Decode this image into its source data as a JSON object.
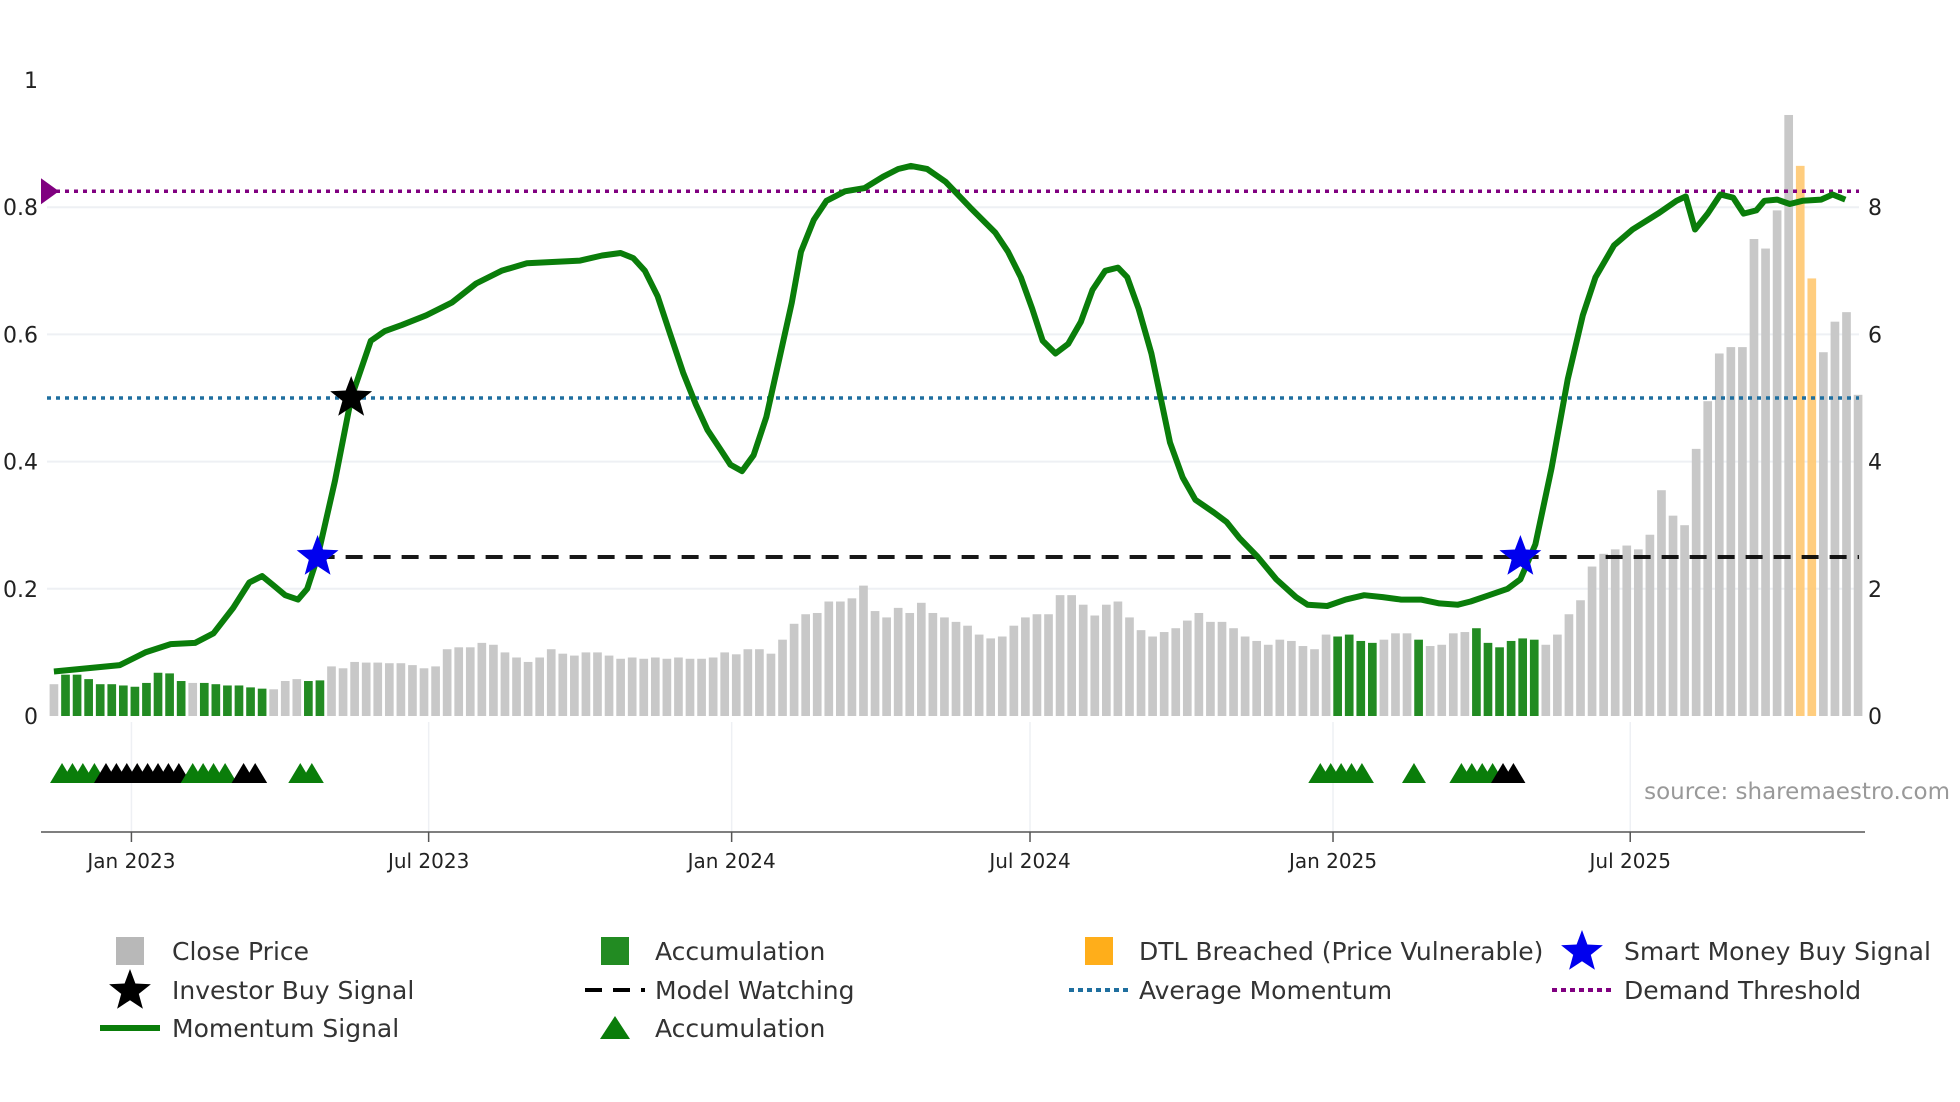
{
  "chart_data": {
    "type": "bar+line",
    "title": "",
    "source": "source: sharemaestro.com",
    "left_axis": {
      "ticks": [
        "0",
        "0.2",
        "0.4",
        "0.6",
        "0.8",
        "1"
      ],
      "values": [
        0,
        0.2,
        0.4,
        0.6,
        0.8,
        1
      ],
      "range": [
        0,
        1
      ]
    },
    "right_axis": {
      "ticks": [
        "0",
        "2",
        "4",
        "6",
        "8"
      ],
      "values": [
        0,
        2,
        4,
        6,
        8
      ],
      "range": [
        0,
        10
      ]
    },
    "x_ticks": [
      {
        "label": "Jan 2023",
        "week": 6.7
      },
      {
        "label": "Jul 2023",
        "week": 32.4
      },
      {
        "label": "Jan 2024",
        "week": 58.6
      },
      {
        "label": "Jul 2024",
        "week": 84.4
      },
      {
        "label": "Jan 2025",
        "week": 110.6
      },
      {
        "label": "Jul 2025",
        "week": 136.3
      }
    ],
    "close_price": [
      0.5,
      0.65,
      0.65,
      0.58,
      0.5,
      0.5,
      0.48,
      0.46,
      0.52,
      0.68,
      0.67,
      0.55,
      0.52,
      0.52,
      0.5,
      0.48,
      0.48,
      0.45,
      0.43,
      0.42,
      0.55,
      0.58,
      0.55,
      0.56,
      0.78,
      0.75,
      0.85,
      0.84,
      0.84,
      0.83,
      0.83,
      0.8,
      0.75,
      0.78,
      1.05,
      1.08,
      1.08,
      1.15,
      1.12,
      1.0,
      0.92,
      0.85,
      0.92,
      1.05,
      0.98,
      0.95,
      1.0,
      1.0,
      0.95,
      0.9,
      0.92,
      0.9,
      0.92,
      0.9,
      0.92,
      0.9,
      0.9,
      0.92,
      1.0,
      0.97,
      1.05,
      1.05,
      0.98,
      1.2,
      1.45,
      1.6,
      1.62,
      1.8,
      1.8,
      1.85,
      2.05,
      1.65,
      1.55,
      1.7,
      1.62,
      1.78,
      1.62,
      1.55,
      1.48,
      1.42,
      1.28,
      1.22,
      1.25,
      1.42,
      1.55,
      1.6,
      1.6,
      1.9,
      1.9,
      1.75,
      1.58,
      1.75,
      1.8,
      1.55,
      1.35,
      1.25,
      1.32,
      1.38,
      1.5,
      1.62,
      1.48,
      1.48,
      1.38,
      1.25,
      1.18,
      1.12,
      1.2,
      1.18,
      1.1,
      1.05,
      1.28,
      1.25,
      1.28,
      1.18,
      1.15,
      1.2,
      1.3,
      1.3,
      1.2,
      1.1,
      1.12,
      1.3,
      1.32,
      1.38,
      1.15,
      1.08,
      1.18,
      1.22,
      1.2,
      1.12,
      1.28,
      1.6,
      1.82,
      2.35,
      2.55,
      2.62,
      2.68,
      2.62,
      2.85,
      3.55,
      3.15,
      3.0,
      4.2,
      4.95,
      5.7,
      5.8,
      5.8,
      7.5,
      7.35,
      7.95,
      9.45,
      8.65,
      6.88,
      5.72,
      6.2,
      6.35,
      5.05
    ],
    "accumulation_bar_indices": [
      1,
      2,
      3,
      4,
      5,
      6,
      7,
      8,
      9,
      10,
      11,
      13,
      14,
      15,
      16,
      17,
      18,
      22,
      23,
      111,
      112,
      113,
      114,
      118,
      123,
      124,
      125,
      126,
      127,
      128
    ],
    "dtl_breached_bar_indices": [
      151,
      152
    ],
    "momentum": [
      [
        0,
        0.07
      ],
      [
        5.7,
        0.08
      ],
      [
        7.9,
        0.1
      ],
      [
        10.1,
        0.113
      ],
      [
        12.2,
        0.115
      ],
      [
        13.8,
        0.13
      ],
      [
        15.5,
        0.17
      ],
      [
        16.9,
        0.21
      ],
      [
        18,
        0.22
      ],
      [
        19,
        0.205
      ],
      [
        20,
        0.19
      ],
      [
        21.1,
        0.183
      ],
      [
        21.9,
        0.2
      ],
      [
        22.8,
        0.25
      ],
      [
        24.3,
        0.37
      ],
      [
        25.7,
        0.5
      ],
      [
        27.4,
        0.59
      ],
      [
        28.6,
        0.605
      ],
      [
        30.1,
        0.615
      ],
      [
        32.2,
        0.63
      ],
      [
        34.4,
        0.65
      ],
      [
        36.5,
        0.68
      ],
      [
        38.7,
        0.7
      ],
      [
        40.9,
        0.712
      ],
      [
        45.5,
        0.716
      ],
      [
        47.4,
        0.724
      ],
      [
        49,
        0.728
      ],
      [
        50.1,
        0.72
      ],
      [
        51.1,
        0.7
      ],
      [
        52.2,
        0.66
      ],
      [
        53.3,
        0.6
      ],
      [
        54.4,
        0.54
      ],
      [
        55.5,
        0.49
      ],
      [
        56.5,
        0.45
      ],
      [
        57.6,
        0.42
      ],
      [
        58.5,
        0.395
      ],
      [
        59.5,
        0.385
      ],
      [
        60.5,
        0.41
      ],
      [
        61.6,
        0.47
      ],
      [
        62.7,
        0.56
      ],
      [
        63.8,
        0.65
      ],
      [
        64.6,
        0.73
      ],
      [
        65.7,
        0.78
      ],
      [
        66.8,
        0.81
      ],
      [
        68.4,
        0.825
      ],
      [
        70.1,
        0.83
      ],
      [
        71.7,
        0.848
      ],
      [
        73,
        0.86
      ],
      [
        74.1,
        0.865
      ],
      [
        75.5,
        0.86
      ],
      [
        77.1,
        0.84
      ],
      [
        79.2,
        0.8
      ],
      [
        81.4,
        0.76
      ],
      [
        82.5,
        0.73
      ],
      [
        83.6,
        0.69
      ],
      [
        84.6,
        0.64
      ],
      [
        85.5,
        0.59
      ],
      [
        86.6,
        0.57
      ],
      [
        87.7,
        0.585
      ],
      [
        88.8,
        0.62
      ],
      [
        89.8,
        0.67
      ],
      [
        90.9,
        0.7
      ],
      [
        92,
        0.705
      ],
      [
        92.8,
        0.69
      ],
      [
        93.8,
        0.64
      ],
      [
        94.9,
        0.57
      ],
      [
        95.7,
        0.5
      ],
      [
        96.5,
        0.43
      ],
      [
        97.6,
        0.375
      ],
      [
        98.7,
        0.34
      ],
      [
        100.3,
        0.32
      ],
      [
        101.4,
        0.305
      ],
      [
        102.5,
        0.28
      ],
      [
        104.1,
        0.25
      ],
      [
        105.7,
        0.215
      ],
      [
        107.4,
        0.187
      ],
      [
        108.4,
        0.175
      ],
      [
        110.1,
        0.173
      ],
      [
        111.7,
        0.183
      ],
      [
        113.3,
        0.19
      ],
      [
        114.9,
        0.187
      ],
      [
        116.5,
        0.183
      ],
      [
        118.2,
        0.183
      ],
      [
        119.8,
        0.177
      ],
      [
        121.4,
        0.175
      ],
      [
        122.5,
        0.18
      ],
      [
        124.1,
        0.19
      ],
      [
        125.7,
        0.2
      ],
      [
        126.8,
        0.215
      ],
      [
        128.1,
        0.27
      ],
      [
        129.5,
        0.39
      ],
      [
        130.9,
        0.53
      ],
      [
        132.2,
        0.63
      ],
      [
        133.3,
        0.69
      ],
      [
        134.9,
        0.74
      ],
      [
        136.5,
        0.765
      ],
      [
        138.7,
        0.79
      ],
      [
        140.3,
        0.81
      ],
      [
        141.1,
        0.817
      ],
      [
        141.9,
        0.765
      ],
      [
        143,
        0.79
      ],
      [
        144.1,
        0.82
      ],
      [
        145.2,
        0.815
      ],
      [
        146.1,
        0.79
      ],
      [
        147.2,
        0.795
      ],
      [
        147.9,
        0.81
      ],
      [
        149,
        0.812
      ],
      [
        150.1,
        0.805
      ],
      [
        151.2,
        0.81
      ],
      [
        152.8,
        0.812
      ],
      [
        153.8,
        0.82
      ],
      [
        154.9,
        0.812
      ]
    ],
    "average_momentum": 0.5,
    "demand_threshold": 0.825,
    "model_watching": {
      "level": 0.25,
      "from_week": 22.8
    },
    "investor_buy_signals": [
      [
        25.7,
        0.5
      ]
    ],
    "smart_money_buy_signals": [
      [
        22.8,
        0.25
      ],
      [
        126.8,
        0.25
      ]
    ],
    "accumulation_markers": [
      {
        "week": 0.7,
        "type": "accumulation"
      },
      {
        "week": 1.6,
        "type": "accumulation"
      },
      {
        "week": 2.5,
        "type": "accumulation"
      },
      {
        "week": 3.5,
        "type": "accumulation"
      },
      {
        "week": 4.5,
        "type": "investor"
      },
      {
        "week": 5.4,
        "type": "investor"
      },
      {
        "week": 6.3,
        "type": "investor"
      },
      {
        "week": 7.2,
        "type": "investor"
      },
      {
        "week": 8.1,
        "type": "investor"
      },
      {
        "week": 9.0,
        "type": "investor"
      },
      {
        "week": 9.9,
        "type": "investor"
      },
      {
        "week": 10.8,
        "type": "investor"
      },
      {
        "week": 12.0,
        "type": "accumulation"
      },
      {
        "week": 12.9,
        "type": "accumulation"
      },
      {
        "week": 13.8,
        "type": "accumulation"
      },
      {
        "week": 14.8,
        "type": "accumulation"
      },
      {
        "week": 16.4,
        "type": "investor"
      },
      {
        "week": 17.4,
        "type": "investor"
      },
      {
        "week": 21.3,
        "type": "accumulation"
      },
      {
        "week": 22.3,
        "type": "accumulation"
      },
      {
        "week": 109.5,
        "type": "accumulation"
      },
      {
        "week": 110.4,
        "type": "accumulation"
      },
      {
        "week": 111.3,
        "type": "accumulation"
      },
      {
        "week": 112.2,
        "type": "accumulation"
      },
      {
        "week": 113.1,
        "type": "accumulation"
      },
      {
        "week": 117.6,
        "type": "accumulation"
      },
      {
        "week": 121.7,
        "type": "accumulation"
      },
      {
        "week": 122.6,
        "type": "accumulation"
      },
      {
        "week": 123.5,
        "type": "accumulation"
      },
      {
        "week": 124.4,
        "type": "accumulation"
      },
      {
        "week": 125.3,
        "type": "investor"
      },
      {
        "week": 126.2,
        "type": "investor"
      }
    ],
    "legend": [
      {
        "label": "Close Price",
        "symbol": "gray-square"
      },
      {
        "label": "Accumulation",
        "symbol": "green-square"
      },
      {
        "label": "DTL Breached (Price Vulnerable)",
        "symbol": "orange-square"
      },
      {
        "label": "Smart Money Buy Signal",
        "symbol": "blue-star"
      },
      {
        "label": "Investor Buy Signal",
        "symbol": "black-star"
      },
      {
        "label": "Model Watching",
        "symbol": "black-dash"
      },
      {
        "label": "Average Momentum",
        "symbol": "blue-dot"
      },
      {
        "label": "Demand Threshold",
        "symbol": "purple-dot"
      },
      {
        "label": "Momentum Signal",
        "symbol": "green-line"
      },
      {
        "label": "Accumulation",
        "symbol": "green-triangle"
      }
    ],
    "legend_placement": "bottom",
    "colors": {
      "close": "#c8c8c8",
      "accumulation": "#228b22",
      "dtl": "#ffc870",
      "momentum": "#0a7d0a",
      "smart": "#0000ee",
      "investor": "#000000",
      "avg": "#1f6f9f",
      "demand": "#800080",
      "grid": "#eef0f4"
    }
  }
}
